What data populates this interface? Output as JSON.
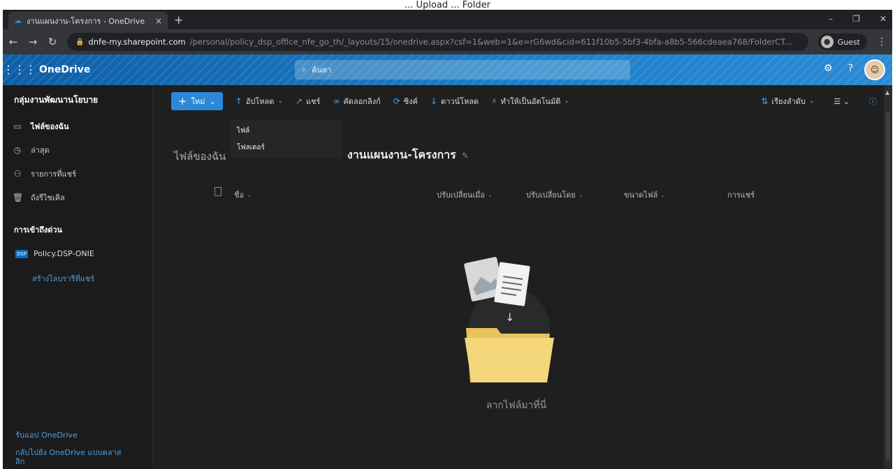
{
  "caption": "... Upload ... Folder",
  "browser": {
    "tab_title": "งานแผนงาน-โครงการ - OneDrive",
    "tab_close": "×",
    "new_tab": "+",
    "host": "dnfe-my.sharepoint.com",
    "path": "/personal/policy_dsp_office_nfe_go_th/_layouts/15/onedrive.aspx?csf=1&web=1&e=rG6wd&cid=611f10b5-5bf3-4bfa-a8b5-566cdeaea768/FolderCT...",
    "guest_label": "Guest",
    "minimize": "–",
    "restore": "❐",
    "close": "✕"
  },
  "header": {
    "app_name": "OneDrive",
    "search_placeholder": "ค้นหา"
  },
  "leftnav": {
    "title": "กลุ่มงานพัฒนานโยบาย",
    "items": [
      {
        "label": "ไฟล์ของฉัน",
        "icon": "folder-icon"
      },
      {
        "label": "ล่าสุด",
        "icon": "recent-icon"
      },
      {
        "label": "รายการที่แชร์",
        "icon": "shared-icon"
      },
      {
        "label": "ถังรีไซเคิล",
        "icon": "recycle-bin-icon"
      }
    ],
    "quick_access_title": "การเข้าถึงด่วน",
    "library_badge": "DSP",
    "library_label": "Policy.DSP-ONIE",
    "create_shared_library": "สร้างไลบรารีที่แชร์",
    "get_apps": "รับแอป OneDrive",
    "classic": "กลับไปยัง OneDrive แบบคลาสสิก"
  },
  "commandbar": {
    "new_label": "ใหม่",
    "upload": "อัปโหลด",
    "share": "แชร์",
    "copy_link": "คัดลอกลิงก์",
    "sync": "ซิงค์",
    "download": "ดาวน์โหลด",
    "automate": "ทำให้เป็นอัตโนมัติ",
    "sort": "เรียงลำดับ"
  },
  "upload_menu": {
    "file": "ไฟล์",
    "folder": "โฟลเดอร์"
  },
  "breadcrumb": {
    "root": "ไฟล์ของฉัน",
    "current": "งานแผนงาน-โครงการ"
  },
  "columns": [
    "ชื่อ",
    "ปรับเปลี่ยนเมื่อ",
    "ปรับเปลี่ยนโดย",
    "ขนาดไฟล์",
    "การแชร์"
  ],
  "empty_state": {
    "label": "ลากไฟล์มาที่นี่"
  }
}
